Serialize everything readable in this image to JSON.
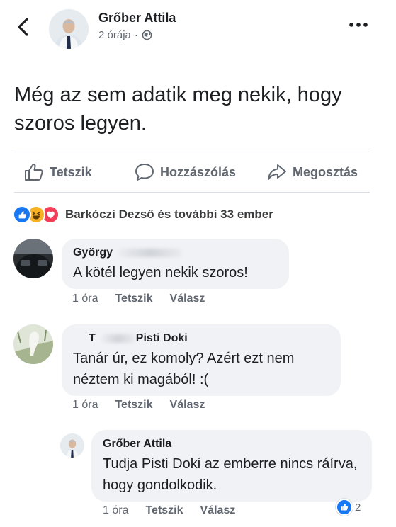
{
  "post": {
    "author": "Grőber Attila",
    "time": "2 órája",
    "separator": "·",
    "text": "Még az sem adatik meg nekik, hogy szoros legyen."
  },
  "actions": {
    "like": "Tetszik",
    "comment": "Hozzászólás",
    "share": "Megosztás"
  },
  "reactions": {
    "summary": "Barkóczi Dezső és további 33 ember",
    "icons": [
      "like-icon",
      "haha-icon",
      "love-icon"
    ],
    "colors": {
      "like": "#1877f2",
      "haha": "#f7b125",
      "love": "#f33e58"
    }
  },
  "comments": [
    {
      "name": "György",
      "text": "A kötél legyen nekik szoros!",
      "time": "1 óra",
      "like": "Tetszik",
      "reply": "Válasz"
    },
    {
      "name_prefix": "T",
      "name": "Pisti Doki",
      "text": "Tanár úr, ez komoly? Azért ezt nem néztem ki magából! :(",
      "time": "1 óra",
      "like": "Tetszik",
      "reply": "Válasz"
    }
  ],
  "reply": {
    "name": "Grőber Attila",
    "text": "Tudja  Pisti Doki az emberre nincs ráírva, hogy gondolkodik.",
    "time": "1 óra",
    "like": "Tetszik",
    "reply": "Válasz",
    "like_count": "2"
  }
}
